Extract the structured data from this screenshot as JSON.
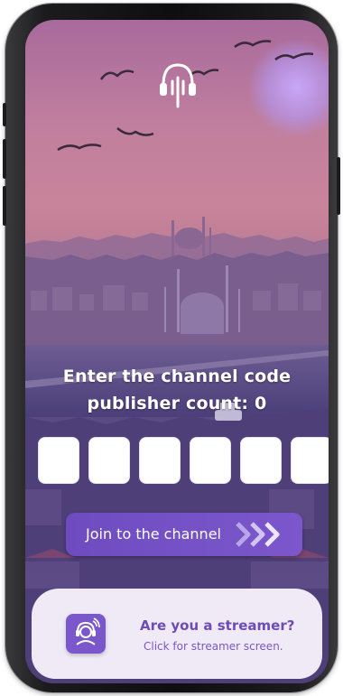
{
  "screen": {
    "heading": "Enter the channel code",
    "publisher_count_text": "publisher count: 0"
  },
  "code_boxes": [
    "",
    "",
    "",
    "",
    "",
    ""
  ],
  "join_button": {
    "label": "Join to the channel"
  },
  "streamer_card": {
    "title": "Are you a streamer?",
    "subtitle": "Click for streamer screen."
  },
  "icons": {
    "logo": "headphones-logo-icon",
    "join": "triple-chevron-right-icon",
    "streamer": "streamer-headset-icon"
  },
  "colors": {
    "accent": "#7b57cc",
    "card_bg": "#efeaf5",
    "card_text": "#6e4cb8"
  }
}
